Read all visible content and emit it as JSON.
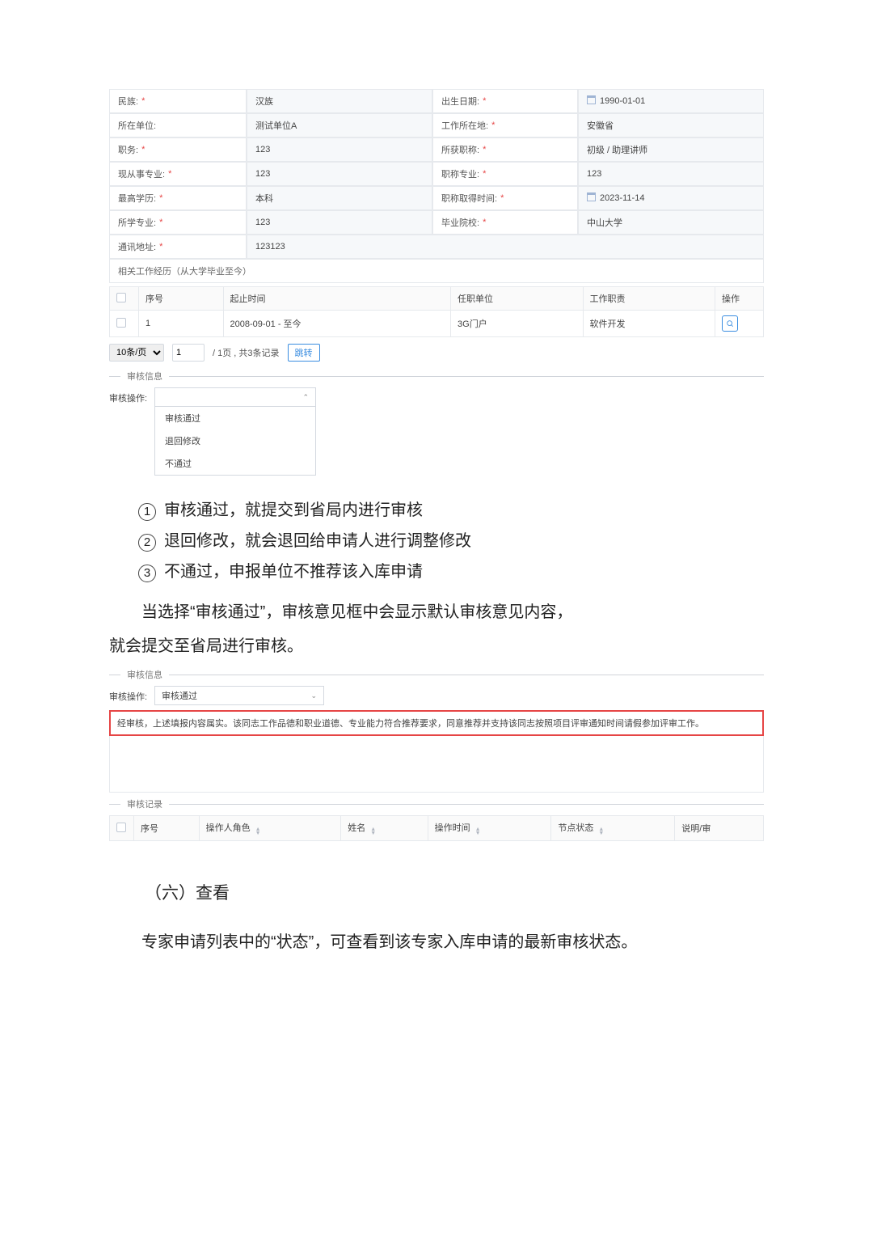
{
  "form": {
    "rows": [
      {
        "l1": "民族:",
        "r1": true,
        "v1": "汉族",
        "l2": "出生日期:",
        "r2": true,
        "v2": "1990-01-01",
        "cal2": true
      },
      {
        "l1": "所在单位:",
        "r1": false,
        "v1": "测试单位A",
        "l2": "工作所在地:",
        "r2": true,
        "v2": "安徽省"
      },
      {
        "l1": "职务:",
        "r1": true,
        "v1": "123",
        "l2": "所获职称:",
        "r2": true,
        "v2": "初级 / 助理讲师"
      },
      {
        "l1": "现从事专业:",
        "r1": true,
        "v1": "123",
        "l2": "职称专业:",
        "r2": true,
        "v2": "123"
      },
      {
        "l1": "最高学历:",
        "r1": true,
        "v1": "本科",
        "l2": "职称取得时间:",
        "r2": true,
        "v2": "2023-11-14",
        "cal2": true
      },
      {
        "l1": "所学专业:",
        "r1": true,
        "v1": "123",
        "l2": "毕业院校:",
        "r2": true,
        "v2": "中山大学"
      }
    ],
    "addr_label": "通讯地址:",
    "addr_req": true,
    "addr_val": "123123",
    "work_title": "相关工作经历（从大学毕业至今）"
  },
  "work_table": {
    "headers": [
      "",
      "序号",
      "起止时间",
      "任职单位",
      "工作职责",
      "操作"
    ],
    "row": {
      "idx": "1",
      "range": "2008-09-01 - 至今",
      "unit": "3G门户",
      "duty": "软件开发"
    }
  },
  "pager": {
    "size": "10条/页",
    "page": "1",
    "info": "/ 1页 , 共3条记录",
    "jump": "跳转"
  },
  "sec_review": "审核信息",
  "review_op_label": "审核操作:",
  "review_options": [
    "审核通过",
    "退回修改",
    "不通过"
  ],
  "article": {
    "lines": [
      "审核通过，就提交到省局内进行审核",
      "退回修改，就会退回给申请人进行调整修改",
      "不通过，申报单位不推荐该入库申请"
    ],
    "nums": [
      "1",
      "2",
      "3"
    ],
    "para1": "当选择“审核通过”，审核意见框中会显示默认审核意见内容，",
    "para2": "就会提交至省局进行审核。"
  },
  "shot2": {
    "sec_review": "审核信息",
    "op_label": "审核操作:",
    "selected": "审核通过",
    "opinion": "经审核，上述填报内容属实。该同志工作品德和职业道德、专业能力符合推荐要求，同意推荐并支持该同志按照项目评审通知时间请假参加评审工作。",
    "sec_log": "审核记录",
    "log_headers": [
      "",
      "序号",
      "操作人角色",
      "姓名",
      "操作时间",
      "节点状态",
      "说明/审"
    ]
  },
  "h6": "（六）查看",
  "para3": "专家申请列表中的“状态”，可查看到该专家入库申请的最新审核状态。"
}
